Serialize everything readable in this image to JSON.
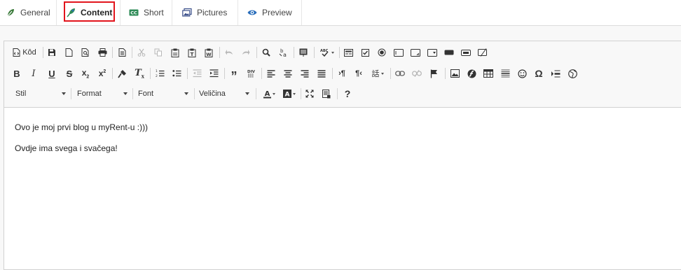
{
  "tabs": [
    {
      "label": "General",
      "icon": "pen-nib-icon"
    },
    {
      "label": "Content",
      "icon": "feather-icon",
      "active": true
    },
    {
      "label": "Short",
      "icon": "cc-icon"
    },
    {
      "label": "Pictures",
      "icon": "images-icon"
    },
    {
      "label": "Preview",
      "icon": "eye-icon"
    }
  ],
  "toolbar": {
    "source_label": "Kôd",
    "styles_label": "Stil",
    "format_label": "Format",
    "font_label": "Font",
    "size_label": "Veličina",
    "help_label": "?"
  },
  "editor": {
    "paragraphs": [
      "Ovo je moj prvi blog u myRent-u :)))",
      "Ovdje ima svega i svačega!"
    ]
  },
  "colors": {
    "highlight_border": "#e2141c",
    "icon_green": "#2e8b57",
    "icon_blue": "#2a6ebb"
  }
}
